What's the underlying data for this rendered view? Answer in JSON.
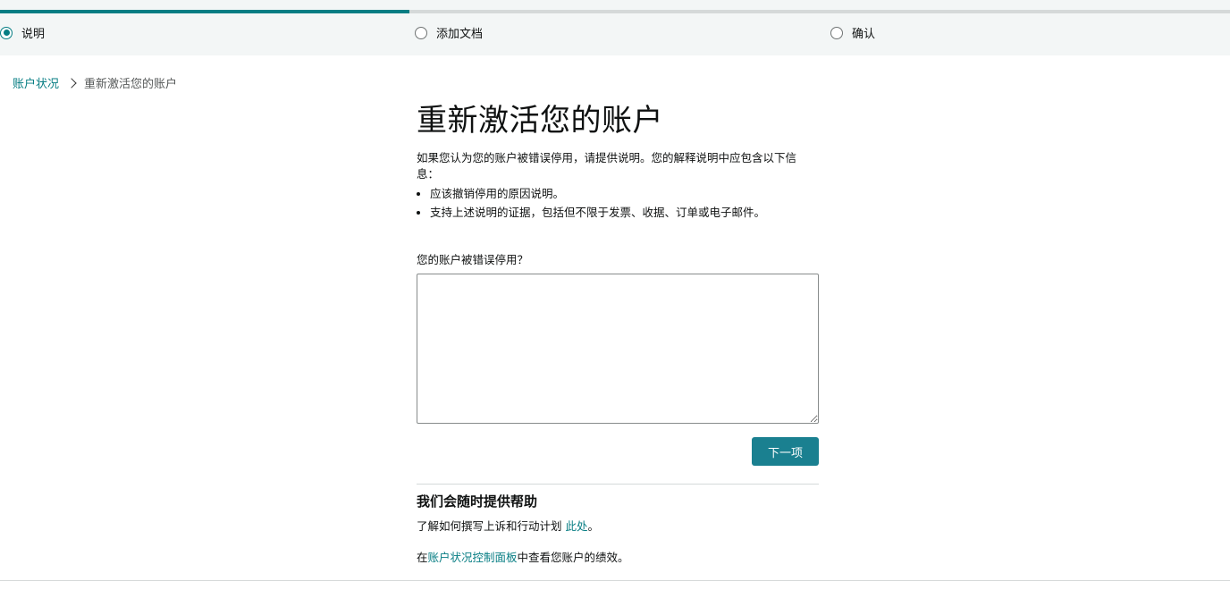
{
  "stepper": {
    "progress": 0.333,
    "steps": [
      {
        "label": "说明",
        "active": true
      },
      {
        "label": "添加文档",
        "active": false
      },
      {
        "label": "确认",
        "active": false
      }
    ]
  },
  "breadcrumb": {
    "parent": "账户状况",
    "current": "重新激活您的账户"
  },
  "main": {
    "title": "重新激活您的账户",
    "intro": "如果您认为您的账户被错误停用，请提供说明。您的解释说明中应包含以下信息：",
    "bullets": [
      "应该撤销停用的原因说明。",
      "支持上述说明的证据，包括但不限于发票、收据、订单或电子邮件。"
    ],
    "question_label": "您的账户被错误停用？",
    "answer_value": "",
    "next_label": "下一项"
  },
  "help": {
    "title": "我们会随时提供帮助",
    "line1_text": "了解如何撰写上诉和行动计划 ",
    "line1_link": "此处",
    "line1_end": "。",
    "line2_start": "在",
    "line2_link": "账户状况控制面板",
    "line2_end": "中查看您账户的绩效。"
  },
  "colors": {
    "accent": "#067d83",
    "button": "#1a8090",
    "stepper_bg": "#f3f6f6"
  }
}
